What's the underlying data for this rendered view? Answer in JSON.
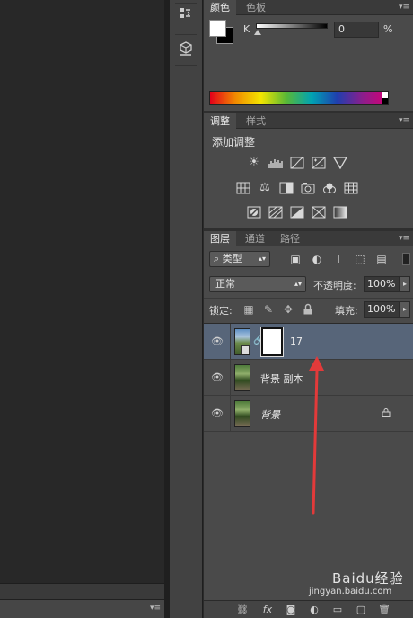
{
  "color_panel": {
    "tabs": [
      {
        "label": "颜色"
      },
      {
        "label": "色板"
      }
    ],
    "k_label": "K",
    "k_value": "0",
    "k_unit": "%"
  },
  "adjustments_panel": {
    "tabs": [
      {
        "label": "调整"
      },
      {
        "label": "样式"
      }
    ],
    "title": "添加调整"
  },
  "layers_panel": {
    "tabs": [
      {
        "label": "图层"
      },
      {
        "label": "通道"
      },
      {
        "label": "路径"
      }
    ],
    "filter_kind": "类型",
    "blend_mode": "正常",
    "opacity_label": "不透明度:",
    "opacity_value": "100%",
    "lock_label": "锁定:",
    "fill_label": "填充:",
    "fill_value": "100%",
    "layers": [
      {
        "name": "17",
        "selected": true
      },
      {
        "name": "背景 副本",
        "selected": false
      },
      {
        "name": "背景",
        "selected": false,
        "locked": true
      }
    ]
  },
  "watermark": {
    "brand": "Baidu经验",
    "url": "jingyan.baidu.com"
  }
}
